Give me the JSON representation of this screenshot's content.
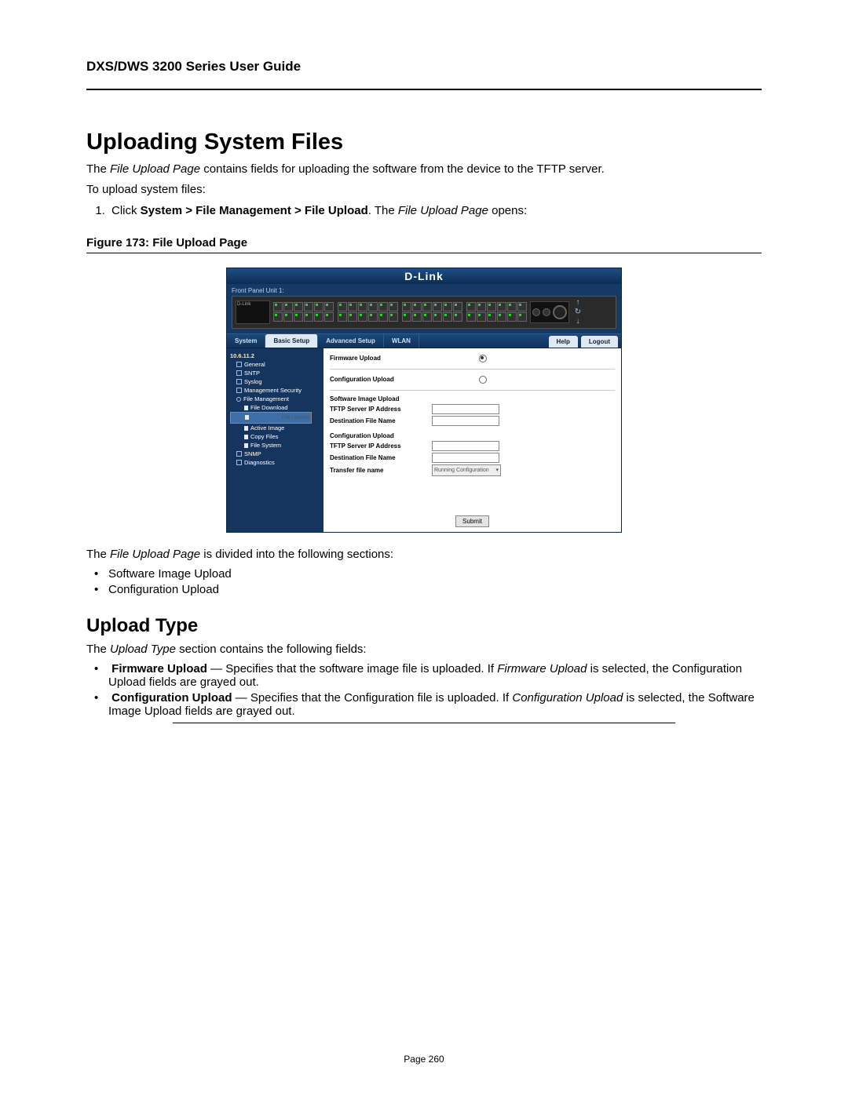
{
  "header": {
    "guide_title": "DXS/DWS 3200 Series User Guide"
  },
  "section1": {
    "title": "Uploading System Files",
    "intro_prefix": "The ",
    "intro_em": "File Upload Page",
    "intro_suffix": " contains fields for uploading the software from the device to the TFTP server.",
    "to_upload": "To upload system files:",
    "step1_prefix": "Click ",
    "step1_bold": "System > File Management > File Upload",
    "step1_mid": ". The ",
    "step1_em": "File Upload Page",
    "step1_suffix": " opens:",
    "figure_caption": "Figure 173: File Upload Page",
    "after_fig_prefix": "The ",
    "after_fig_em": "File Upload Page",
    "after_fig_suffix": " is divided into the following sections:",
    "bullets": [
      "Software Image Upload",
      "Configuration Upload"
    ]
  },
  "section2": {
    "title": "Upload Type",
    "intro_prefix": "The ",
    "intro_em": "Upload Type",
    "intro_suffix": " section contains the following fields:",
    "items": [
      {
        "bold": "Firmware Upload",
        "dash": " — ",
        "text1": "Specifies that the software image file is uploaded. If ",
        "em": "Firmware Upload",
        "text2": " is selected, the Configuration Upload fields are grayed out."
      },
      {
        "bold": "Configuration Upload",
        "dash": " — ",
        "text1": "Specifies that the Configuration file is uploaded. If ",
        "em": "Configuration Upload",
        "text2": " is selected, the Software Image Upload fields are grayed out."
      }
    ]
  },
  "footer": {
    "page_label": "Page 260"
  },
  "ui": {
    "brand": "D-Link",
    "front_panel_label": "Front Panel Unit 1:",
    "switch_brand_text": "D-Link",
    "tabs": {
      "system": "System",
      "basic": "Basic Setup",
      "advanced": "Advanced Setup",
      "wlan": "WLAN",
      "help": "Help",
      "logout": "Logout"
    },
    "tree": {
      "root": "10.6.11.2",
      "items": [
        {
          "label": "General",
          "level": 1,
          "icon": "sq"
        },
        {
          "label": "SNTP",
          "level": 1,
          "icon": "sq"
        },
        {
          "label": "Syslog",
          "level": 1,
          "icon": "sq"
        },
        {
          "label": "Management Security",
          "level": 1,
          "icon": "sq"
        },
        {
          "label": "File Management",
          "level": 1,
          "icon": "circ"
        },
        {
          "label": "File Download",
          "level": 2,
          "icon": "doc"
        },
        {
          "label": "File Upload",
          "level": 2,
          "icon": "doc",
          "selected": true
        },
        {
          "label": "Active Image",
          "level": 2,
          "icon": "doc"
        },
        {
          "label": "Copy Files",
          "level": 2,
          "icon": "doc"
        },
        {
          "label": "File System",
          "level": 2,
          "icon": "doc"
        },
        {
          "label": "SNMP",
          "level": 1,
          "icon": "sq"
        },
        {
          "label": "Diagnostics",
          "level": 1,
          "icon": "sq"
        }
      ]
    },
    "form": {
      "radio_fw": "Firmware Upload",
      "radio_cfg": "Configuration Upload",
      "hdr_sw": "Software Image Upload",
      "tftp_ip": "TFTP Server IP Address",
      "dest_file": "Destination File Name",
      "hdr_cfg": "Configuration Upload",
      "transfer_file": "Transfer file name",
      "transfer_value": "Running Configuration",
      "submit": "Submit"
    }
  }
}
